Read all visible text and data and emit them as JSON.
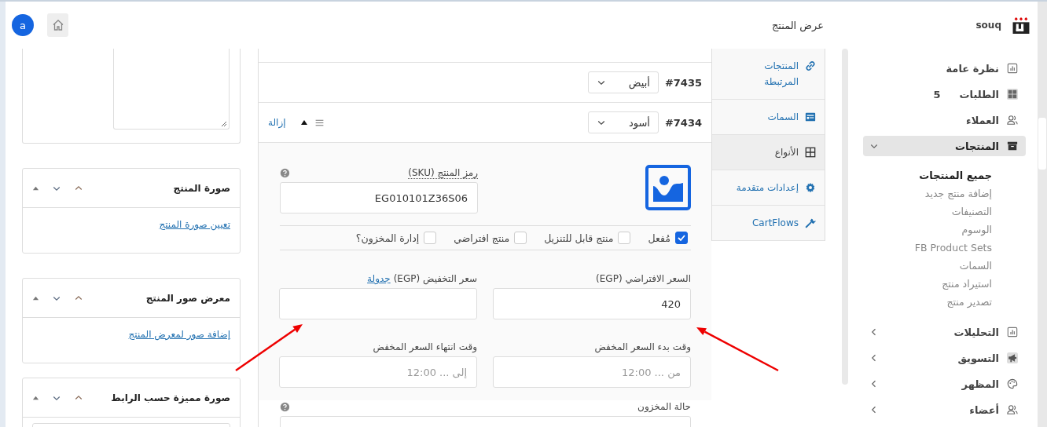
{
  "header": {
    "avatar": "a",
    "page_title": "عرض المنتج",
    "brand": "souq"
  },
  "sidebar": {
    "items": [
      {
        "label": "نظرة عامة"
      },
      {
        "label": "الطلبات",
        "badge": "5"
      },
      {
        "label": "العملاء"
      },
      {
        "label": "المنتجات",
        "expanded": true,
        "selected": true,
        "children": [
          {
            "label": "جميع المنتجات",
            "selected": true
          },
          {
            "label": "إضافة منتج جديد",
            "selected": false
          },
          {
            "label": "التصنيفات",
            "selected": false
          },
          {
            "label": "الوسوم",
            "selected": false
          },
          {
            "label": "FB Product Sets",
            "selected": false
          },
          {
            "label": "السمات",
            "selected": false
          },
          {
            "label": "استيراد منتج",
            "selected": false
          },
          {
            "label": "تصدير منتج",
            "selected": false
          }
        ]
      },
      {
        "label": "التحليلات",
        "expanded": false,
        "selected": false
      },
      {
        "label": "التسويق",
        "expanded": false,
        "selected": false
      },
      {
        "label": "المظهر",
        "expanded": false,
        "selected": false
      },
      {
        "label": "أعضاء",
        "expanded": false,
        "selected": false
      }
    ]
  },
  "meta_boxes": [
    {
      "kind": "textarea"
    },
    {
      "kind": "link",
      "title": "صورة المنتج",
      "link": "تعيين صورة المنتج"
    },
    {
      "kind": "link",
      "title": "معرض صور المنتج",
      "link": "إضافة صور لمعرض المنتج"
    },
    {
      "kind": "field",
      "title": "صورة مميزة حسب الرابط"
    }
  ],
  "product_tabs": [
    {
      "label": "المنتجات المرتبطة",
      "selected": false
    },
    {
      "label": "السمات",
      "selected": false
    },
    {
      "label": "الأنواع",
      "selected": true
    },
    {
      "label": "إعدادات متقدمة",
      "selected": false
    },
    {
      "label": "CartFlows",
      "selected": false
    }
  ],
  "variations": [
    {
      "id": "#7435",
      "value": "أبيض"
    },
    {
      "id": "#7434",
      "value": "أسود",
      "expanded": true,
      "remove_link": "إزالة"
    }
  ],
  "variation_form": {
    "sku_label": "رمز المنتج (SKU)",
    "sku": "EG010101Z36S06",
    "options": [
      {
        "label": "مُفعل",
        "checked": true
      },
      {
        "label": "منتج قابل للتنزيل",
        "checked": false
      },
      {
        "label": "منتج افتراضي",
        "checked": false
      },
      {
        "label": "إدارة المخزون؟",
        "checked": false
      }
    ],
    "regular_price_label": "السعر الافتراضي (EGP)",
    "regular_price": "420",
    "sale_price_label": "سعر التخفيض (EGP)",
    "schedule_link": "جدولة",
    "sale_start_label": "وقت بدء السعر المخفض",
    "sale_start_placeholder": "من ... 12:00",
    "sale_end_label": "وقت انتهاء السعر المخفض",
    "sale_end_placeholder": "إلى ... 12:00",
    "stock_status_label": "حالة المخزون"
  },
  "annotations": [
    {
      "kind": "arrow"
    },
    {
      "kind": "arrow"
    }
  ]
}
